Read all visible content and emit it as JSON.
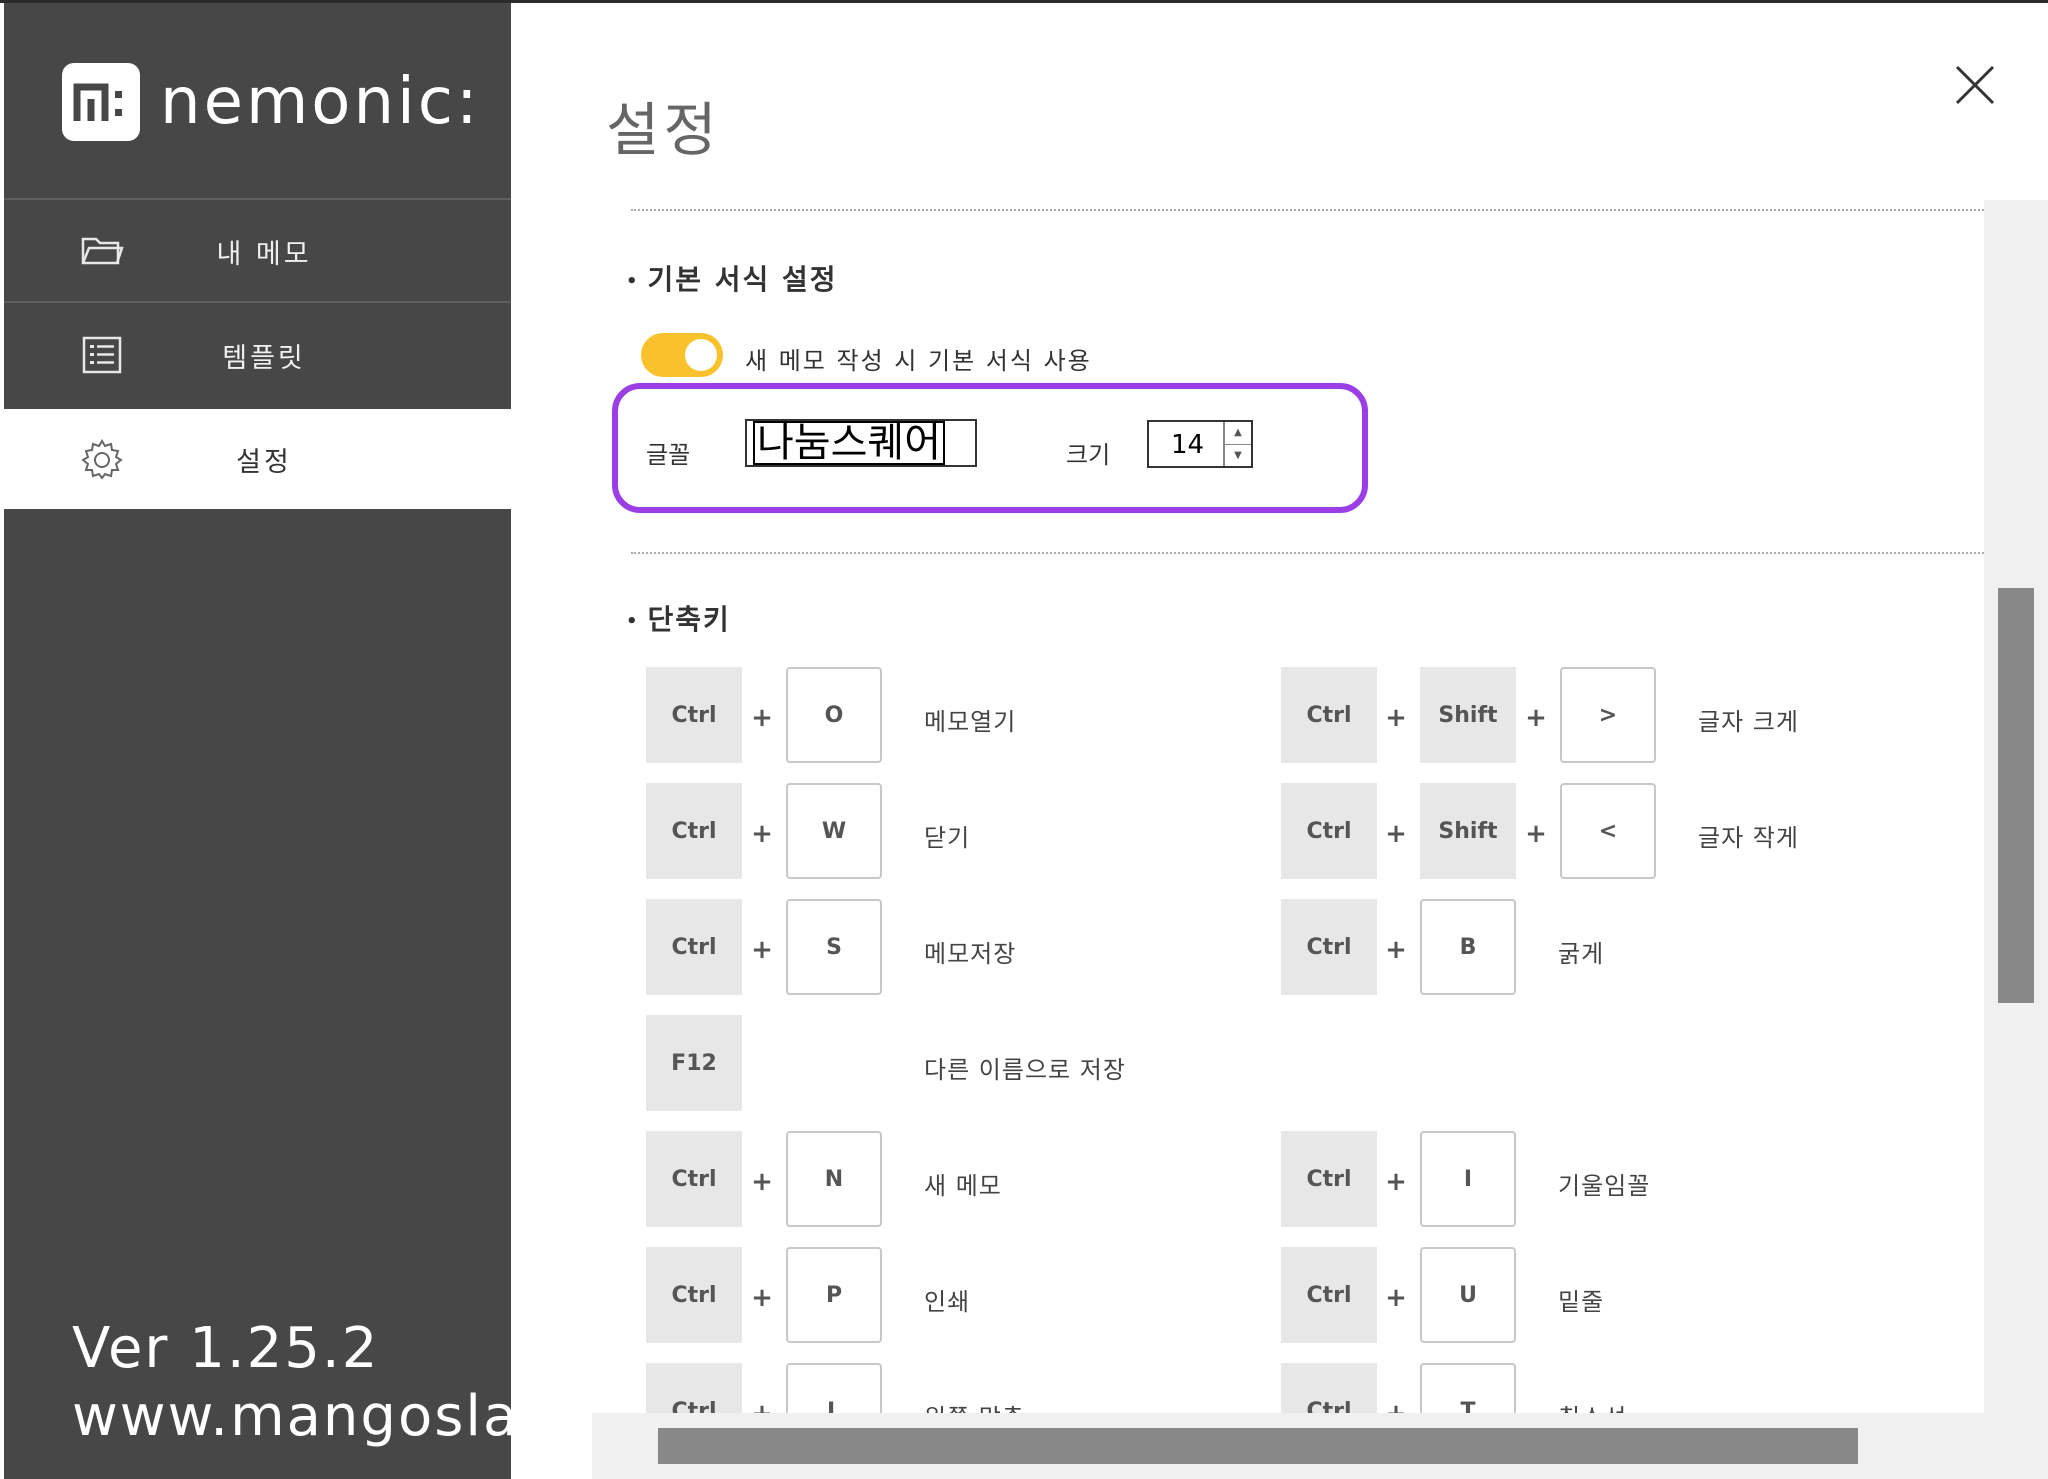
{
  "app": {
    "logo_text": "nemonic:",
    "version_line": "Ver 1.25.2",
    "url_line": "www.mangoslab.com"
  },
  "sidebar": {
    "items": [
      {
        "label": "내 메모",
        "icon": "folder-icon"
      },
      {
        "label": "템플릿",
        "icon": "list-icon"
      },
      {
        "label": "설정",
        "icon": "gear-icon"
      }
    ],
    "active": "설정"
  },
  "main": {
    "title": "설정",
    "format_section": {
      "title": "기본 서식 설정",
      "toggle_label": "새 메모 작성 시 기본 서식 사용",
      "toggle_on": true,
      "font_label": "글꼴",
      "font_value": "나눔스퀘어",
      "size_label": "크기",
      "size_value": "14"
    },
    "shortcut_section": {
      "title": "단축키",
      "left": [
        {
          "keys": [
            "Ctrl",
            "O"
          ],
          "desc": "메모열기"
        },
        {
          "keys": [
            "Ctrl",
            "W"
          ],
          "desc": "닫기"
        },
        {
          "keys": [
            "Ctrl",
            "S"
          ],
          "desc": "메모저장"
        },
        {
          "keys": [
            "F12"
          ],
          "desc": "다른 이름으로 저장"
        },
        {
          "keys": [
            "Ctrl",
            "N"
          ],
          "desc": "새 메모"
        },
        {
          "keys": [
            "Ctrl",
            "P"
          ],
          "desc": "인쇄"
        },
        {
          "keys": [
            "Ctrl",
            "L"
          ],
          "desc": "왼쪽 맞춤"
        }
      ],
      "right": [
        {
          "keys": [
            "Ctrl",
            "Shift",
            ">"
          ],
          "desc": "글자 크게"
        },
        {
          "keys": [
            "Ctrl",
            "Shift",
            "<"
          ],
          "desc": "글자 작게"
        },
        {
          "keys": [
            "Ctrl",
            "B"
          ],
          "desc": "굵게"
        },
        {
          "keys": [
            "Ctrl",
            "I"
          ],
          "desc": "기울임꼴"
        },
        {
          "keys": [
            "Ctrl",
            "U"
          ],
          "desc": "밑줄"
        },
        {
          "keys": [
            "Ctrl",
            "T"
          ],
          "desc": "취소선"
        }
      ]
    }
  },
  "colors": {
    "sidebar_bg": "#474747",
    "toggle_on": "#f9c22c",
    "highlight": "#9b3ee6"
  }
}
